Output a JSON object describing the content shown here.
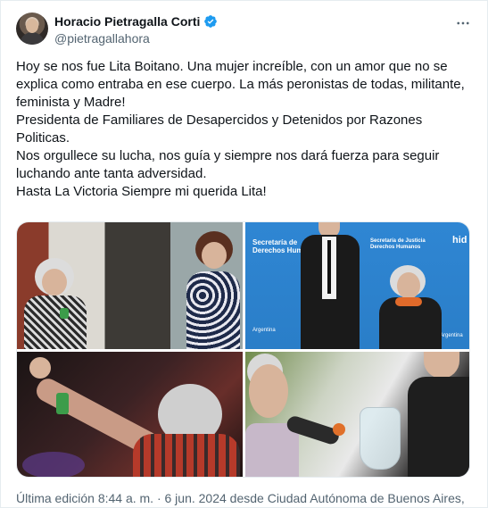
{
  "author": {
    "name": "Horacio Pietragalla Corti",
    "handle": "@pietragallahora"
  },
  "tweet": {
    "paragraphs": [
      "Hoy se nos fue Lita Boitano. Una mujer increíble, con un amor que no se explica como entraba en ese cuerpo. La más peronistas de todas, militante, feminista y Madre!",
      "Presidenta de Familiares de Desapercidos y Detenidos por Razones Politicas.",
      "Nos orgullece su lucha, nos guía y siempre nos dará fuerza para seguir luchando ante tanta adversidad.",
      "Hasta La Victoria Siempre mi querida Lita!"
    ]
  },
  "photos": {
    "photo2_banner_left": "Secretaría de\nDerechos Humanos",
    "photo2_banner_right": "Secretaría de Justicia\nDerechos Humanos",
    "photo2_corner": "hid",
    "photo2_logo_left": "Argentina",
    "photo2_logo_right": "Argentina"
  },
  "footer": {
    "text": "Última edición 8:44 a. m. · 6 jun. 2024 desde Ciudad Autónoma de Buenos Aires,"
  },
  "icons": {
    "verified": "verified-badge-icon",
    "more": "more-options-icon"
  },
  "colors": {
    "verified_blue": "#1d9bf0",
    "secondary_text": "#536471"
  }
}
